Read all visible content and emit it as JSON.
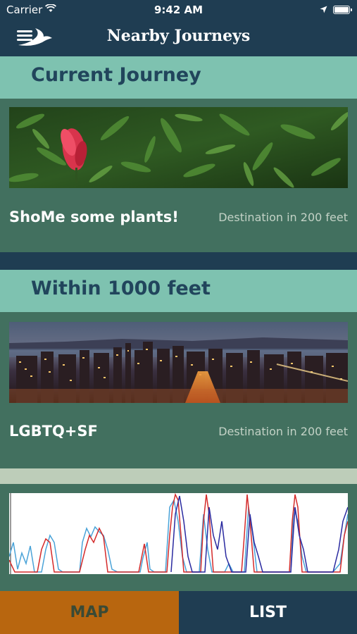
{
  "status_bar": {
    "carrier": "Carrier",
    "time": "9:42 AM"
  },
  "nav": {
    "title": "Nearby Journeys",
    "menu_icon": "menu-logo-icon"
  },
  "sections": {
    "current": {
      "header": "Current Journey",
      "card": {
        "title": "ShoMe some plants!",
        "meta": "Destination in 200 feet",
        "image": "red-flower-photo"
      }
    },
    "nearby": {
      "header": "Within 1000 feet",
      "card": {
        "title": "LGBTQ+SF",
        "meta": "Destination in 200 feet",
        "image": "city-night-panorama-photo"
      }
    },
    "third": {
      "image": "waveform-graph-image"
    }
  },
  "tabs": {
    "map": "MAP",
    "list": "LIST"
  },
  "colors": {
    "navy": "#1f3d52",
    "teal": "#7ec2b0",
    "green": "#42705f",
    "orange": "#b8660f"
  }
}
